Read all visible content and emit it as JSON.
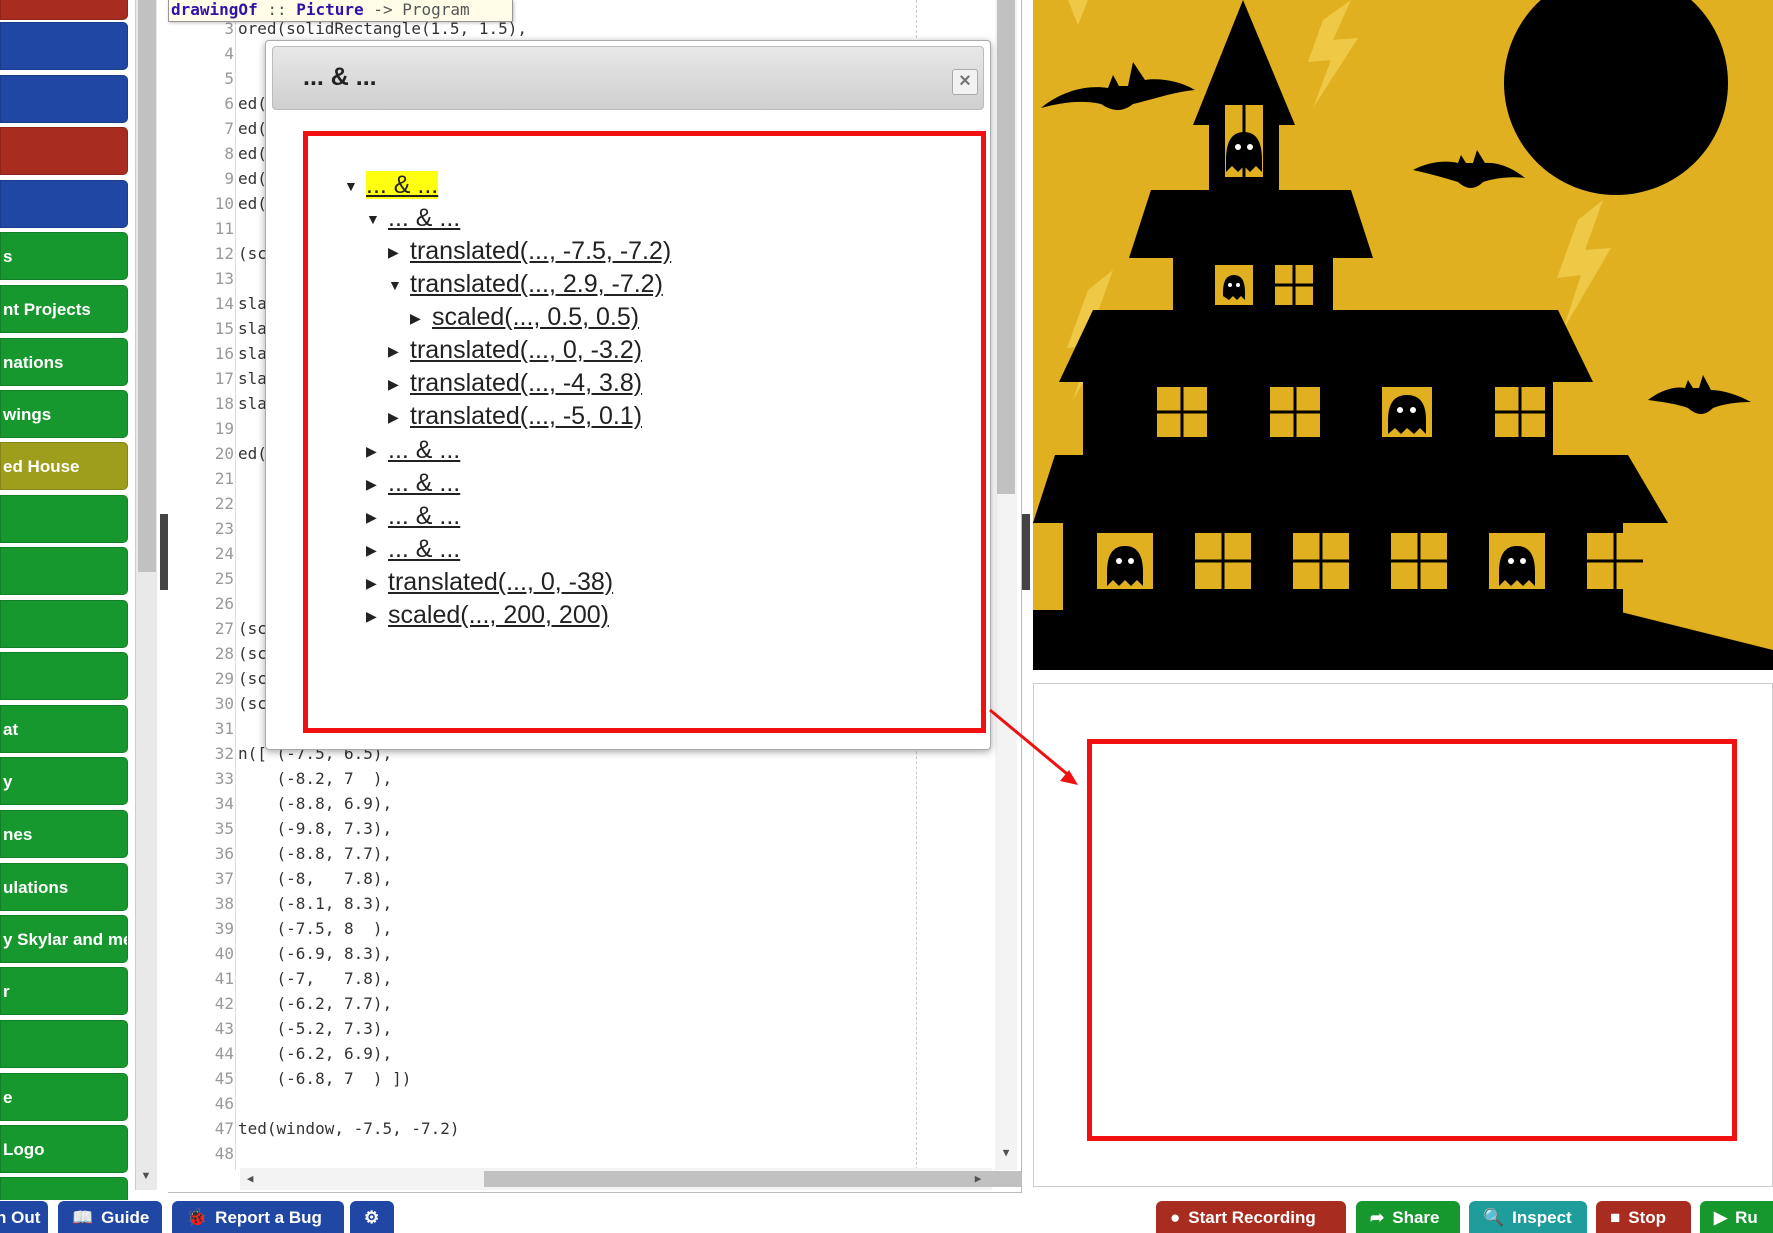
{
  "sidebar": {
    "items": [
      {
        "label": "",
        "color": "#a82c1f"
      },
      {
        "label": "",
        "color": "#1f47a3"
      },
      {
        "label": "",
        "color": "#1f47a3"
      },
      {
        "label": "",
        "color": "#a82c1f"
      },
      {
        "label": "",
        "color": "#1f47a3"
      },
      {
        "label": "s",
        "color": "#17982e"
      },
      {
        "label": "nt Projects",
        "color": "#17982e"
      },
      {
        "label": "nations",
        "color": "#17982e"
      },
      {
        "label": "wings",
        "color": "#17982e"
      },
      {
        "label": "ed House",
        "color": "#9e9d1c"
      },
      {
        "label": "",
        "color": "#17982e"
      },
      {
        "label": "",
        "color": "#17982e"
      },
      {
        "label": "",
        "color": "#17982e"
      },
      {
        "label": "",
        "color": "#17982e"
      },
      {
        "label": "at",
        "color": "#17982e"
      },
      {
        "label": "y",
        "color": "#17982e"
      },
      {
        "label": "nes",
        "color": "#17982e"
      },
      {
        "label": "ulations",
        "color": "#17982e"
      },
      {
        "label": "y Skylar and me",
        "color": "#17982e"
      },
      {
        "label": "r",
        "color": "#17982e"
      },
      {
        "label": "",
        "color": "#17982e"
      },
      {
        "label": "e",
        "color": "#17982e"
      },
      {
        "label": "Logo",
        "color": "#17982e"
      },
      {
        "label": "",
        "color": "#17982e"
      }
    ]
  },
  "editor": {
    "signature": {
      "name": "drawingOf",
      "sep": " :: ",
      "type1": "Picture",
      "arrow": " -> ",
      "type2": "Program"
    },
    "lines": [
      {
        "n": "3",
        "text": "ored(solidRectangle(1.5, 1.5),"
      },
      {
        "n": "4",
        "text": ""
      },
      {
        "n": "5",
        "text": ""
      },
      {
        "n": "6",
        "text": "ed("
      },
      {
        "n": "7",
        "text": "ed("
      },
      {
        "n": "8",
        "text": "ed("
      },
      {
        "n": "9",
        "text": "ed("
      },
      {
        "n": "10",
        "text": "ed("
      },
      {
        "n": "11",
        "text": ""
      },
      {
        "n": "12",
        "text": "(sc"
      },
      {
        "n": "13",
        "text": ""
      },
      {
        "n": "14",
        "text": "sla"
      },
      {
        "n": "15",
        "text": "sla"
      },
      {
        "n": "16",
        "text": "sla"
      },
      {
        "n": "17",
        "text": "sla"
      },
      {
        "n": "18",
        "text": "sla"
      },
      {
        "n": "19",
        "text": ""
      },
      {
        "n": "20",
        "text": "ed("
      },
      {
        "n": "21",
        "text": ""
      },
      {
        "n": "22",
        "text": ""
      },
      {
        "n": "23",
        "text": ""
      },
      {
        "n": "24",
        "text": ""
      },
      {
        "n": "25",
        "text": ""
      },
      {
        "n": "26",
        "text": ""
      },
      {
        "n": "27",
        "text": "(sc"
      },
      {
        "n": "28",
        "text": "(sc"
      },
      {
        "n": "29",
        "text": "(sc"
      },
      {
        "n": "30",
        "text": "(sc"
      },
      {
        "n": "31",
        "text": ""
      },
      {
        "n": "32",
        "text": "n([ (-7.5, 6.5),"
      },
      {
        "n": "33",
        "text": "    (-8.2, 7  ),"
      },
      {
        "n": "34",
        "text": "    (-8.8, 6.9),"
      },
      {
        "n": "35",
        "text": "    (-9.8, 7.3),"
      },
      {
        "n": "36",
        "text": "    (-8.8, 7.7),"
      },
      {
        "n": "37",
        "text": "    (-8,   7.8),"
      },
      {
        "n": "38",
        "text": "    (-8.1, 8.3),"
      },
      {
        "n": "39",
        "text": "    (-7.5, 8  ),"
      },
      {
        "n": "40",
        "text": "    (-6.9, 8.3),"
      },
      {
        "n": "41",
        "text": "    (-7,   7.8),"
      },
      {
        "n": "42",
        "text": "    (-6.2, 7.7),"
      },
      {
        "n": "43",
        "text": "    (-5.2, 7.3),"
      },
      {
        "n": "44",
        "text": "    (-6.2, 6.9),"
      },
      {
        "n": "45",
        "text": "    (-6.8, 7  ) ])"
      },
      {
        "n": "46",
        "text": ""
      },
      {
        "n": "47",
        "text": "ted(window, -7.5, -7.2)"
      },
      {
        "n": "48",
        "text": ""
      }
    ]
  },
  "dialog": {
    "title": "... & ...",
    "close_icon": "×",
    "tree": [
      {
        "depth": 0,
        "toggle": "▼",
        "label": "... & ...",
        "highlight": true
      },
      {
        "depth": 1,
        "toggle": "▼",
        "label": "... & ..."
      },
      {
        "depth": 2,
        "toggle": "▶",
        "label": "translated(..., -7.5, -7.2)"
      },
      {
        "depth": 2,
        "toggle": "▼",
        "label": "translated(..., 2.9, -7.2)"
      },
      {
        "depth": 3,
        "toggle": "▶",
        "label": "scaled(..., 0.5, 0.5)"
      },
      {
        "depth": 2,
        "toggle": "▶",
        "label": "translated(..., 0, -3.2)"
      },
      {
        "depth": 2,
        "toggle": "▶",
        "label": "translated(..., -4, 3.8)"
      },
      {
        "depth": 2,
        "toggle": "▶",
        "label": "translated(..., -5, 0.1)"
      },
      {
        "depth": 1,
        "toggle": "▶",
        "label": "... & ..."
      },
      {
        "depth": 1,
        "toggle": "▶",
        "label": "... & ..."
      },
      {
        "depth": 1,
        "toggle": "▶",
        "label": "... & ..."
      },
      {
        "depth": 1,
        "toggle": "▶",
        "label": "... & ..."
      },
      {
        "depth": 1,
        "toggle": "▶",
        "label": "translated(..., 0, -38)"
      },
      {
        "depth": 1,
        "toggle": "▶",
        "label": "scaled(..., 200, 200)"
      }
    ]
  },
  "output": {
    "background": "#e0b021",
    "highlight_color": "#f01010"
  },
  "toolbar": {
    "left": [
      {
        "name": "sign-out-button",
        "label": "n Out",
        "icon": "",
        "color": "#1f47a3"
      },
      {
        "name": "guide-button",
        "label": "Guide",
        "icon": "📖",
        "color": "#1f47a3"
      },
      {
        "name": "report-bug-button",
        "label": "Report a Bug",
        "icon": "🐞",
        "color": "#1f47a3"
      },
      {
        "name": "debug-button",
        "label": "",
        "icon": "⚙",
        "color": "#1f47a3"
      }
    ],
    "right": [
      {
        "name": "start-recording-button",
        "label": "Start Recording",
        "icon": "●",
        "color": "#a82c1f"
      },
      {
        "name": "share-button",
        "label": "Share",
        "icon": "➦",
        "color": "#17982e"
      },
      {
        "name": "inspect-button",
        "label": "Inspect",
        "icon": "🔍",
        "color": "#1f9d9d"
      },
      {
        "name": "stop-button",
        "label": "Stop",
        "icon": "■",
        "color": "#a82c1f"
      },
      {
        "name": "run-button",
        "label": "Ru",
        "icon": "▶",
        "color": "#17982e"
      }
    ]
  }
}
